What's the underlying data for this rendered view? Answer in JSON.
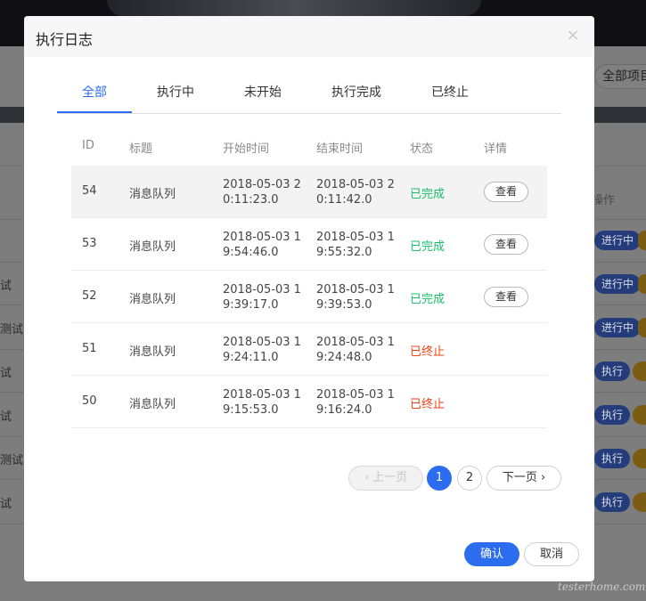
{
  "background": {
    "filter_select": "全部项目",
    "column_header": "操作",
    "left_texts": [
      "试",
      "测试",
      "试",
      "试",
      "测试",
      "试"
    ],
    "pills": [
      "进行中",
      "进行中",
      "进行中",
      "执行",
      "执行",
      "执行",
      "执行"
    ],
    "watermark": "testerhome.com"
  },
  "modal": {
    "title": "执行日志",
    "close_icon": "×",
    "tabs": [
      {
        "label": "全部",
        "active": true
      },
      {
        "label": "执行中",
        "active": false
      },
      {
        "label": "未开始",
        "active": false
      },
      {
        "label": "执行完成",
        "active": false
      },
      {
        "label": "已终止",
        "active": false
      }
    ],
    "table": {
      "headers": [
        "ID",
        "标题",
        "开始时间",
        "结束时间",
        "状态",
        "详情"
      ],
      "rows": [
        {
          "id": "54",
          "title": "消息队列",
          "start": "2018-05-03 20:11:23.0",
          "end": "2018-05-03 20:11:42.0",
          "status": "已完成",
          "detail": "查看"
        },
        {
          "id": "53",
          "title": "消息队列",
          "start": "2018-05-03 19:54:46.0",
          "end": "2018-05-03 19:55:32.0",
          "status": "已完成",
          "detail": "查看"
        },
        {
          "id": "52",
          "title": "消息队列",
          "start": "2018-05-03 19:39:17.0",
          "end": "2018-05-03 19:39:53.0",
          "status": "已完成",
          "detail": "查看"
        },
        {
          "id": "51",
          "title": "消息队列",
          "start": "2018-05-03 19:24:11.0",
          "end": "2018-05-03 19:24:48.0",
          "status": "已终止",
          "detail": ""
        },
        {
          "id": "50",
          "title": "消息队列",
          "start": "2018-05-03 19:15:53.0",
          "end": "2018-05-03 19:16:24.0",
          "status": "已终止",
          "detail": ""
        }
      ]
    },
    "pagination": {
      "prev_label": "上一页",
      "pages": [
        "1",
        "2"
      ],
      "current_page": "1",
      "next_label": "下一页"
    },
    "footer": {
      "confirm_label": "确认",
      "cancel_label": "取消"
    },
    "colors": {
      "accent": "#2c6df0",
      "status_done": "#19be6b",
      "status_stopped": "#ed4014"
    }
  }
}
